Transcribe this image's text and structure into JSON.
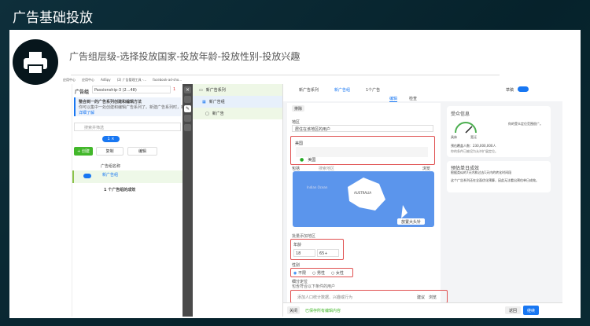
{
  "slide": {
    "title": "广告基础投放",
    "subtitle": "广告组层级-选择投放国家-投放年龄-投放性别-投放兴趣",
    "icon": "printer-icon"
  },
  "bookmarks": [
    "应用中心",
    "应用中心",
    "AdSpy",
    "(2) 广告管理工具 -...",
    "facebook-ad-sho..."
  ],
  "left_panel": {
    "title": "广告组",
    "account": "Passionship-3 (2...48)",
    "alert_count": "1",
    "notice_title": "整合到一的广告系列创建和编辑方法",
    "notice_body": "你可以集中一处创建和编辑广告系列了。新建广告系列时，新",
    "notice_link": "详细了解",
    "search_placeholder": "搜索并筛选",
    "tab_badge": "1 ×",
    "create": "+ 创建",
    "copy": "复制",
    "edit": "编辑",
    "col_name": "广告组名称",
    "row_name": "新广告组",
    "summary": "1 个广告组的成效"
  },
  "tree": {
    "campaign": "新广告系列",
    "adset": "新广告组",
    "ad": "新广告"
  },
  "breadcrumb": {
    "campaign": "新广告系列",
    "adset": "新广告组",
    "ad": "1个广告",
    "status": "草稿"
  },
  "editor_tabs": {
    "edit": "编辑",
    "review": "检查"
  },
  "form": {
    "remove": "排除",
    "location_label": "地区",
    "location_select": "居住在该地区的用户",
    "included_label": "美国",
    "included_item": "美国",
    "include_select": "包括",
    "search_location": "搜索地区",
    "browse": "浏览",
    "map_ocean": "Indian Ocean",
    "map_country": "AUSTRALIA",
    "drop_pin": "放置大头针",
    "bulk_add": "批量添加地区",
    "age_label": "年龄",
    "age_min": "18",
    "age_max": "65+",
    "gender_label": "性别",
    "genders": [
      "不限",
      "男性",
      "女性"
    ],
    "gender_selected": "不限",
    "detailed_label": "细分定位",
    "detailed_hint": "包含符合以下条件的用户",
    "detailed_placeholder": "添加人口统计数据、兴趣或行为",
    "suggest": "建议",
    "browse2": "浏览"
  },
  "info": {
    "audience_title": "受众信息",
    "audience_desc": "你的受众定位范围很广。",
    "gauge_low": "具体",
    "gauge_high": "宽泛",
    "reach": "预估覆盖人数：230,000,000人",
    "reach_note": "你的条件已被设为允许扩展定位。",
    "result_title": "预估单日成效",
    "result_desc": "根据类似的7天内和过去1天内的转化时间段",
    "result_note": "这个广告系列还在全面优化预算，因此无法看出预估单日成效。"
  },
  "footer": {
    "close": "关闭",
    "saved": "已保存所有编辑内容",
    "back": "返回",
    "next": "继续"
  },
  "colors": {
    "accent": "#1877f2",
    "create": "#42b72a",
    "highlight": "#e05050"
  }
}
